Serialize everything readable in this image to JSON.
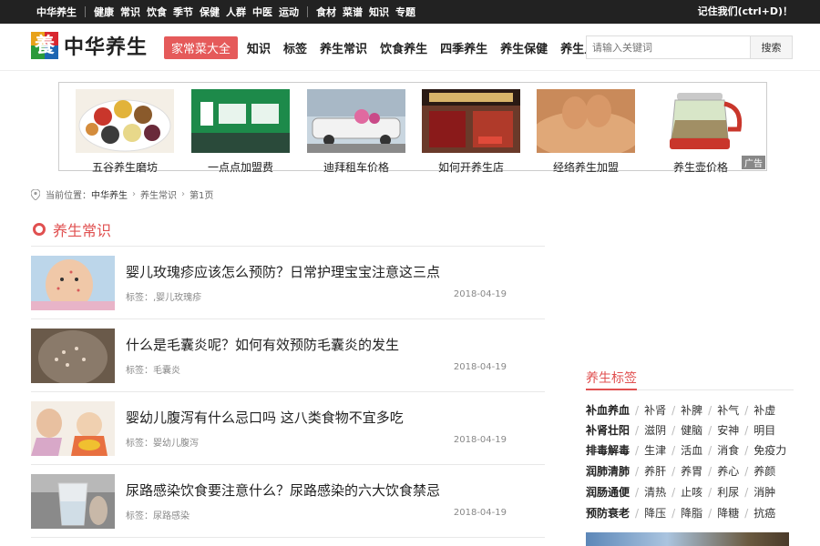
{
  "topbar": {
    "site": "中华养生",
    "links_a": [
      "健康",
      "常识",
      "饮食",
      "季节",
      "保健",
      "人群",
      "中医",
      "运动"
    ],
    "links_b": [
      "食材",
      "菜谱",
      "知识",
      "专题"
    ],
    "bookmark": "记住我们(ctrl+D)！"
  },
  "header": {
    "logo_char": "養",
    "logo_text": "中华养生",
    "hot_label": "家常菜大全",
    "nav": [
      "知识",
      "标签",
      "养生常识",
      "饮食养生",
      "四季养生",
      "养生保健",
      "养生人群"
    ],
    "search_placeholder": "请输入关键词",
    "search_button": "搜索"
  },
  "ads": {
    "items": [
      "五谷养生磨坊",
      "一点点加盟费",
      "迪拜租车价格",
      "如何开养生店",
      "经络养生加盟",
      "养生壶价格"
    ],
    "tag": "广告"
  },
  "breadcrumb": {
    "prefix": "当前位置：",
    "items": [
      "中华养生",
      "养生常识",
      "第1页"
    ]
  },
  "section_title": "养生常识",
  "articles": [
    {
      "title": "婴儿玫瑰疹应该怎么预防？日常护理宝宝注意这三点",
      "tags": "标签：,婴儿玫瑰疹",
      "date": "2018-04-19"
    },
    {
      "title": "什么是毛囊炎呢？如何有效预防毛囊炎的发生",
      "tags": "标签：毛囊炎",
      "date": "2018-04-19"
    },
    {
      "title": "婴幼儿腹泻有什么忌口吗 这八类食物不宜多吃",
      "tags": "标签：婴幼儿腹泻",
      "date": "2018-04-19"
    },
    {
      "title": "尿路感染饮食要注意什么？尿路感染的六大饮食禁忌",
      "tags": "标签：尿路感染",
      "date": "2018-04-19"
    }
  ],
  "sidebar": {
    "title": "养生标签",
    "rows": [
      [
        "补血养血",
        "补肾",
        "补脾",
        "补气",
        "补虚"
      ],
      [
        "补肾壮阳",
        "滋阴",
        "健脑",
        "安神",
        "明目"
      ],
      [
        "排毒解毒",
        "生津",
        "活血",
        "消食",
        "免疫力"
      ],
      [
        "润肺清肺",
        "养肝",
        "养胃",
        "养心",
        "养颜"
      ],
      [
        "润肠通便",
        "清热",
        "止咳",
        "利尿",
        "消肿"
      ],
      [
        "预防衰老",
        "降压",
        "降脂",
        "降糖",
        "抗癌"
      ]
    ]
  },
  "colors": {
    "accent": "#e05050",
    "topbar": "#222222",
    "hot": "#e55a5a"
  }
}
